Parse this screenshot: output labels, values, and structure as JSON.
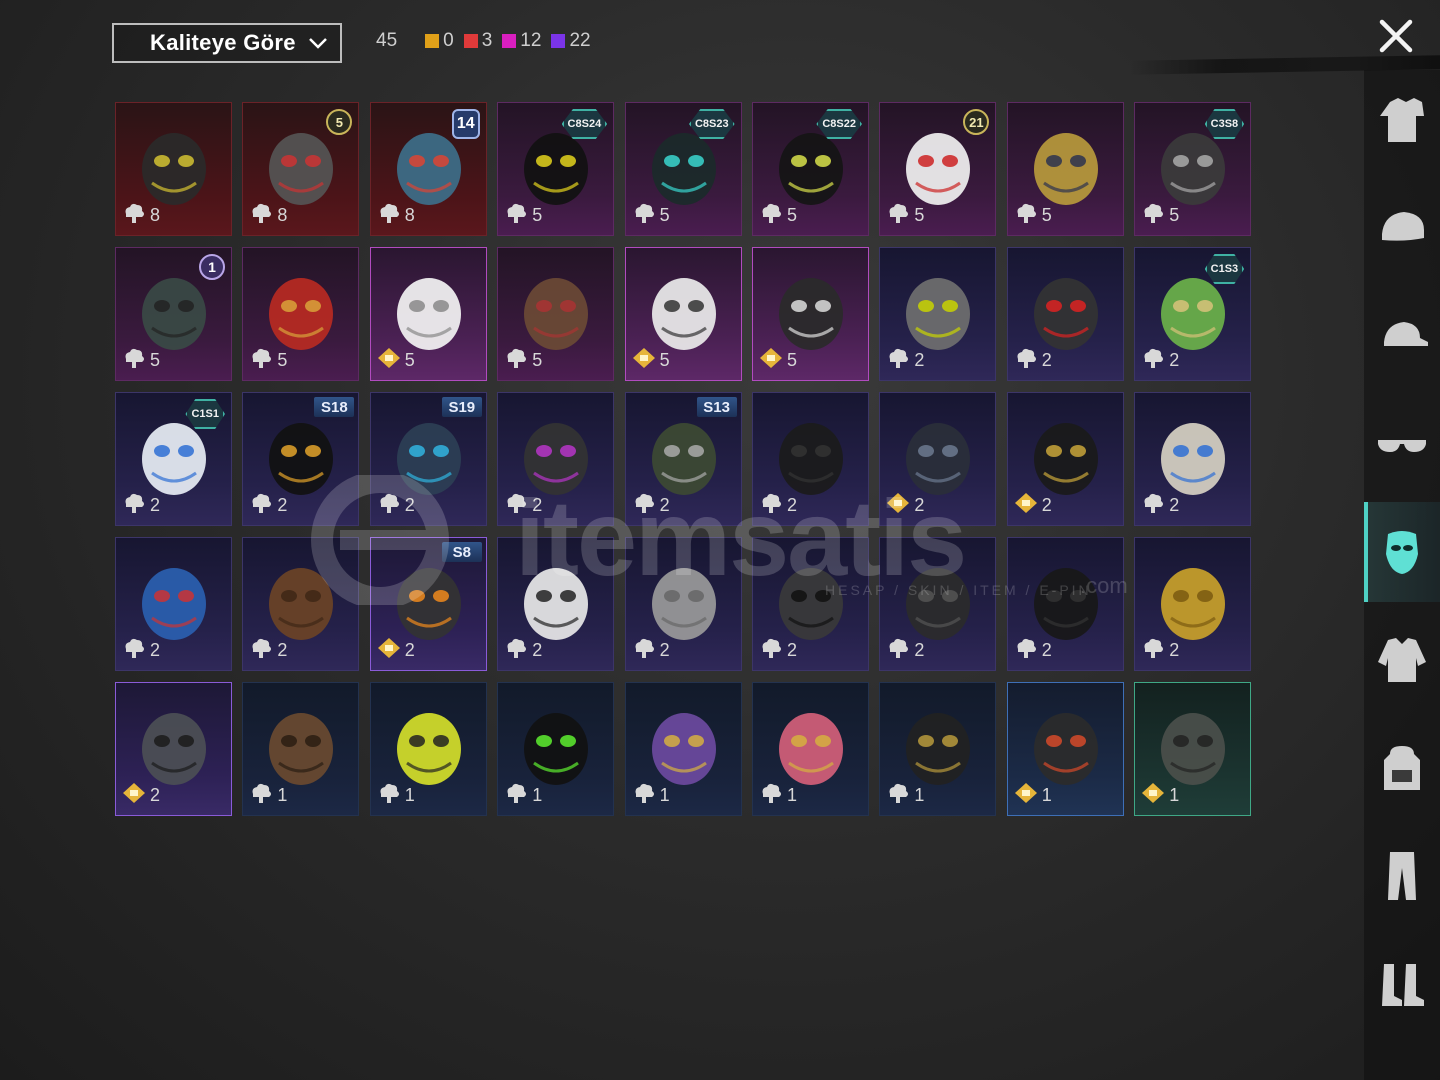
{
  "header": {
    "sort_label": "Kaliteye Göre",
    "total_count": "45",
    "rarity_counts": [
      {
        "color": "#e0a019",
        "value": "0"
      },
      {
        "color": "#e03a3a",
        "value": "3"
      },
      {
        "color": "#d91fbf",
        "value": "12"
      },
      {
        "color": "#7b34e8",
        "value": "22"
      }
    ]
  },
  "items": [
    {
      "rarity": "red",
      "count": "8",
      "icon": "bp-icon",
      "badge": null,
      "art": "helmet-mask"
    },
    {
      "rarity": "red",
      "count": "8",
      "icon": "bp-icon",
      "badge": {
        "type": "lvl",
        "text": "5"
      },
      "art": "gear-mask"
    },
    {
      "rarity": "red",
      "count": "8",
      "icon": "bp-icon",
      "badge": {
        "type": "lvlblue",
        "text": "14"
      },
      "art": "robot-mask"
    },
    {
      "rarity": "pink",
      "count": "5",
      "icon": "bp-icon",
      "badge": {
        "type": "hex",
        "text": "C8S24"
      },
      "art": "yellow-visor"
    },
    {
      "rarity": "pink",
      "count": "5",
      "icon": "bp-icon",
      "badge": {
        "type": "hex",
        "text": "C8S23"
      },
      "art": "teal-mask"
    },
    {
      "rarity": "pink",
      "count": "5",
      "icon": "bp-icon",
      "badge": {
        "type": "hex",
        "text": "C8S22"
      },
      "art": "black-mask"
    },
    {
      "rarity": "pink",
      "count": "5",
      "icon": "bp-icon",
      "badge": {
        "type": "lvl",
        "text": "21"
      },
      "art": "clown-mask"
    },
    {
      "rarity": "pink",
      "count": "5",
      "icon": "bp-icon",
      "badge": null,
      "art": "gold-headpiece"
    },
    {
      "rarity": "pink",
      "count": "5",
      "icon": "bp-icon",
      "badge": {
        "type": "hex",
        "text": "C3S8"
      },
      "art": "respirator"
    },
    {
      "rarity": "pink",
      "count": "5",
      "icon": "bp-icon",
      "badge": {
        "type": "lvlpurple",
        "text": "1"
      },
      "art": "cage-mask"
    },
    {
      "rarity": "pink",
      "count": "5",
      "icon": "bp-icon",
      "badge": null,
      "art": "red-eyemask"
    },
    {
      "rarity": "pinkhi",
      "count": "5",
      "icon": "ag-icon",
      "badge": null,
      "art": "white-cloth"
    },
    {
      "rarity": "pink",
      "count": "5",
      "icon": "bp-icon",
      "badge": null,
      "art": "plague-mask"
    },
    {
      "rarity": "pinkhi",
      "count": "5",
      "icon": "ag-icon",
      "badge": null,
      "art": "white-hood"
    },
    {
      "rarity": "pinkhi",
      "count": "5",
      "icon": "ag-icon",
      "badge": null,
      "art": "skull-bandana"
    },
    {
      "rarity": "purple",
      "count": "2",
      "icon": "bp-icon",
      "badge": null,
      "art": "grey-mask"
    },
    {
      "rarity": "purple",
      "count": "2",
      "icon": "bp-icon",
      "badge": null,
      "art": "red-goggle"
    },
    {
      "rarity": "purple",
      "count": "2",
      "icon": "bp-icon",
      "badge": {
        "type": "hex",
        "text": "C1S3"
      },
      "art": "green-bandana"
    },
    {
      "rarity": "purple",
      "count": "2",
      "icon": "bp-icon",
      "badge": {
        "type": "hex",
        "text": "C1S1"
      },
      "art": "blue-facemask"
    },
    {
      "rarity": "purple",
      "count": "2",
      "icon": "bp-icon",
      "badge": {
        "type": "season",
        "text": "S18"
      },
      "art": "pulse-mask"
    },
    {
      "rarity": "purple",
      "count": "2",
      "icon": "bp-icon",
      "badge": {
        "type": "season",
        "text": "S19"
      },
      "art": "blue-visor"
    },
    {
      "rarity": "purple",
      "count": "2",
      "icon": "bp-icon",
      "badge": null,
      "art": "purple-gasmask"
    },
    {
      "rarity": "purple",
      "count": "2",
      "icon": "bp-icon",
      "badge": {
        "type": "season",
        "text": "S13"
      },
      "art": "green-goggle"
    },
    {
      "rarity": "purple",
      "count": "2",
      "icon": "bp-icon",
      "badge": null,
      "art": "dark-neck"
    },
    {
      "rarity": "purple",
      "count": "2",
      "icon": "ag-icon",
      "badge": null,
      "art": "dark-bandana"
    },
    {
      "rarity": "purple",
      "count": "2",
      "icon": "ag-icon",
      "badge": null,
      "art": "ninja-mask"
    },
    {
      "rarity": "purple",
      "count": "2",
      "icon": "bp-icon",
      "badge": null,
      "art": "beige-bandana"
    },
    {
      "rarity": "purple",
      "count": "2",
      "icon": "bp-icon",
      "badge": null,
      "art": "paisley-bandana"
    },
    {
      "rarity": "purple",
      "count": "2",
      "icon": "bp-icon",
      "badge": null,
      "art": "mustache"
    },
    {
      "rarity": "purplehi",
      "count": "2",
      "icon": "ag-icon",
      "badge": {
        "type": "season",
        "text": "S8"
      },
      "art": "flame-bandana"
    },
    {
      "rarity": "purple",
      "count": "2",
      "icon": "bp-icon",
      "badge": null,
      "art": "grin-mask"
    },
    {
      "rarity": "purple",
      "count": "2",
      "icon": "bp-icon",
      "badge": null,
      "art": "grey-facemask"
    },
    {
      "rarity": "purple",
      "count": "2",
      "icon": "bp-icon",
      "badge": null,
      "art": "dark-skull"
    },
    {
      "rarity": "purple",
      "count": "2",
      "icon": "bp-icon",
      "badge": null,
      "art": "black-cage"
    },
    {
      "rarity": "purple",
      "count": "2",
      "icon": "bp-icon",
      "badge": null,
      "art": "black-neck"
    },
    {
      "rarity": "purple",
      "count": "2",
      "icon": "bp-icon",
      "badge": null,
      "art": "gold-facemask"
    },
    {
      "rarity": "purplehi",
      "count": "2",
      "icon": "ag-icon",
      "badge": null,
      "art": "steel-mask"
    },
    {
      "rarity": "blue",
      "count": "1",
      "icon": "bp-icon",
      "badge": null,
      "art": "rusty-mask"
    },
    {
      "rarity": "blue",
      "count": "1",
      "icon": "bp-icon",
      "badge": null,
      "art": "dot-bandana"
    },
    {
      "rarity": "blue",
      "count": "1",
      "icon": "bp-icon",
      "badge": null,
      "art": "web-bandana"
    },
    {
      "rarity": "blue",
      "count": "1",
      "icon": "bp-icon",
      "badge": null,
      "art": "purple-theater"
    },
    {
      "rarity": "blue",
      "count": "1",
      "icon": "bp-icon",
      "badge": null,
      "art": "pink-theater"
    },
    {
      "rarity": "blue",
      "count": "1",
      "icon": "bp-icon",
      "badge": null,
      "art": "black-facemask"
    },
    {
      "rarity": "bluehi",
      "count": "1",
      "icon": "ag-icon",
      "badge": null,
      "art": "half-respirator"
    },
    {
      "rarity": "green",
      "count": "1",
      "icon": "ag-icon",
      "badge": null,
      "art": "gasmask"
    }
  ],
  "sidebar": [
    {
      "name": "outfit-icon",
      "active": false
    },
    {
      "name": "hat-icon",
      "active": false
    },
    {
      "name": "cap-icon",
      "active": false
    },
    {
      "name": "glasses-icon",
      "active": false
    },
    {
      "name": "mask-icon",
      "active": true
    },
    {
      "name": "jacket-icon",
      "active": false
    },
    {
      "name": "backpack-icon",
      "active": false
    },
    {
      "name": "pants-icon",
      "active": false
    },
    {
      "name": "boots-icon",
      "active": false
    }
  ],
  "watermark": {
    "brand": "itemsatis",
    "sub": "HESAP / SKIN / ITEM / E-PIN",
    "com": ".com"
  },
  "colors": {
    "accent": "#4fd1c5",
    "bp_icon": "#d8d8d8",
    "ag_icon": "#e6b53a"
  }
}
